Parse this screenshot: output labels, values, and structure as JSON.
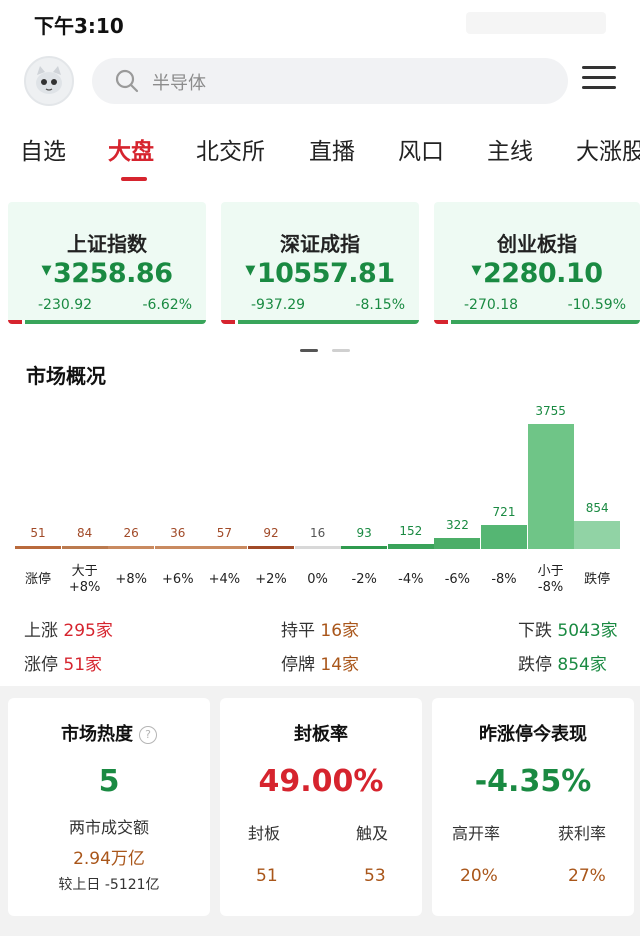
{
  "status_bar": {
    "time": "下午3:10"
  },
  "search": {
    "placeholder": "半导体"
  },
  "tabs": [
    "自选",
    "大盘",
    "北交所",
    "直播",
    "风口",
    "主线",
    "大涨股"
  ],
  "active_tab": 1,
  "indices": [
    {
      "name": "上证指数",
      "value": "3258.86",
      "change": "-230.92",
      "pct": "-6.62%"
    },
    {
      "name": "深证成指",
      "value": "10557.81",
      "change": "-937.29",
      "pct": "-8.15%"
    },
    {
      "name": "创业板指",
      "value": "2280.10",
      "change": "-270.18",
      "pct": "-10.59%"
    }
  ],
  "market_overview": {
    "title": "市场概况",
    "chart_data": {
      "type": "bar",
      "categories": [
        "涨停",
        "大于\n+8%",
        "+8%",
        "+6%",
        "+4%",
        "+2%",
        "0%",
        "-2%",
        "-4%",
        "-6%",
        "-8%",
        "小于\n-8%",
        "跌停"
      ],
      "values": [
        51,
        84,
        26,
        36,
        57,
        92,
        16,
        93,
        152,
        322,
        721,
        3755,
        854
      ]
    },
    "up_label": "上涨",
    "up_value": "295家",
    "flat_label": "持平",
    "flat_value": "16家",
    "down_label": "下跌",
    "down_value": "5043家",
    "limit_up_label": "涨停",
    "limit_up_value": "51家",
    "suspended_label": "停牌",
    "suspended_value": "14家",
    "limit_down_label": "跌停",
    "limit_down_value": "854家"
  },
  "heat_card": {
    "title": "市场热度",
    "value": "5",
    "turnover_label": "两市成交额",
    "turnover_value": "2.94万亿",
    "compare": "较上日 -5121亿"
  },
  "seal_card": {
    "title": "封板率",
    "value": "49.00%",
    "sealed_label": "封板",
    "sealed_value": "51",
    "touched_label": "触及",
    "touched_value": "53"
  },
  "prev_card": {
    "title": "昨涨停今表现",
    "value": "-4.35%",
    "open_label": "高开率",
    "open_value": "20%",
    "profit_label": "获利率",
    "profit_value": "27%"
  },
  "colors": {
    "up": "#d6242e",
    "down": "#1a8a42",
    "accent": "#d6242e"
  }
}
